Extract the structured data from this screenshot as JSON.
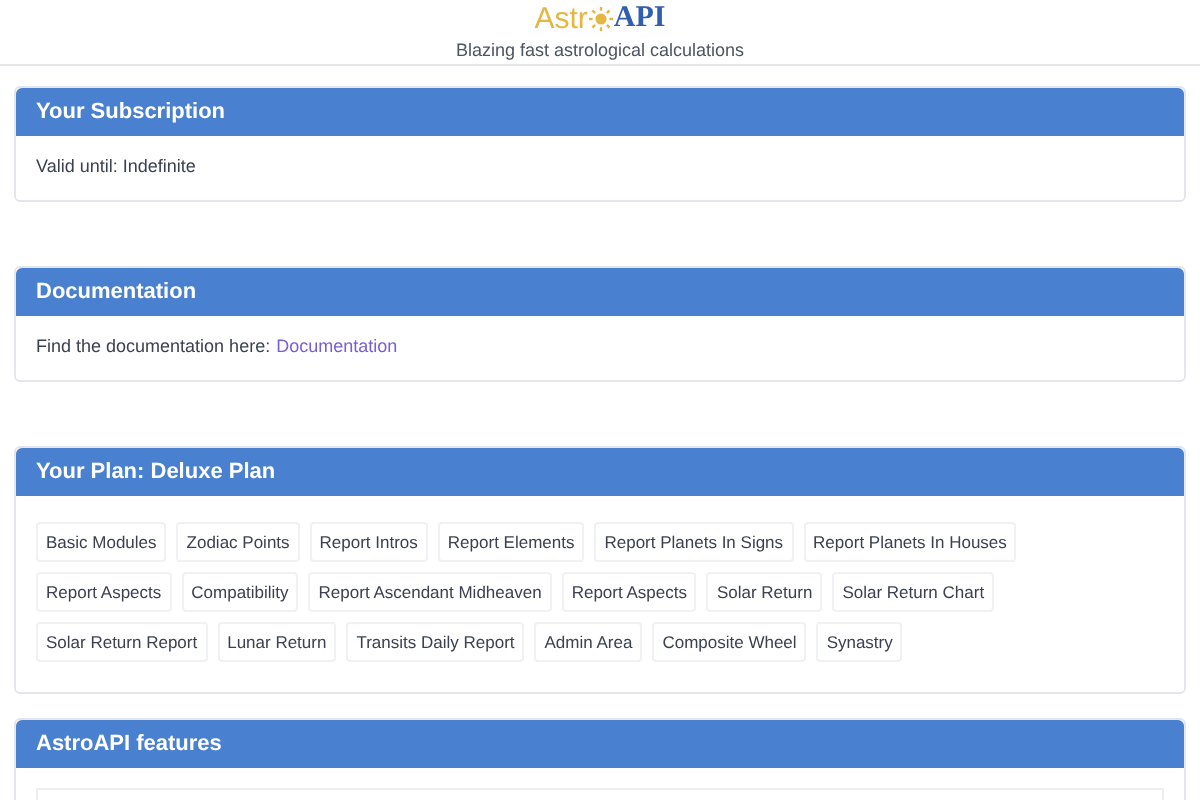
{
  "logo": {
    "part_1": "Astr",
    "part_2": "API"
  },
  "tagline": "Blazing fast astrological calculations",
  "subscription": {
    "title": "Your Subscription",
    "text": "Valid until: Indefinite"
  },
  "documentation": {
    "title": "Documentation",
    "text": "Find the documentation here:",
    "link": "Documentation"
  },
  "plan": {
    "title": "Your Plan: Deluxe Plan",
    "modules": [
      "Basic Modules",
      "Zodiac Points",
      "Report Intros",
      "Report Elements",
      "Report Planets In Signs",
      "Report Planets In Houses",
      "Report Aspects",
      "Compatibility",
      "Report Ascendant Midheaven",
      "Report Aspects",
      "Solar Return",
      "Solar Return Chart",
      "Solar Return Report",
      "Lunar Return",
      "Transits Daily Report",
      "Admin Area",
      "Composite Wheel",
      "Synastry"
    ]
  },
  "features": {
    "title": "AstroAPI features"
  }
}
